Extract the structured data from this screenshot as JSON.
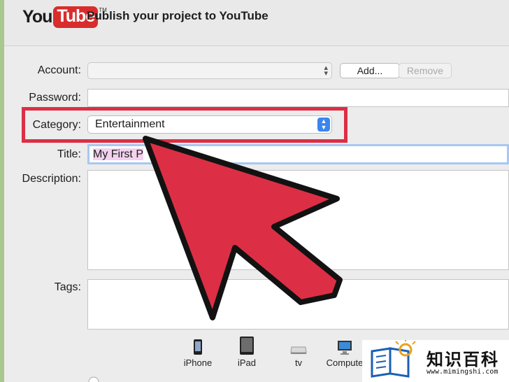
{
  "header": {
    "logo_you": "You",
    "logo_tube": "Tube",
    "logo_tm": "TM",
    "title": "Publish your project to YouTube"
  },
  "form": {
    "account_label": "Account:",
    "account_value": "",
    "add_button": "Add...",
    "remove_button": "Remove",
    "password_label": "Password:",
    "category_label": "Category:",
    "category_value": "Entertainment",
    "title_label": "Title:",
    "title_value": "My First P",
    "description_label": "Description:",
    "tags_label": "Tags:"
  },
  "devices": [
    {
      "label": "iPhone",
      "icon": "iphone-icon"
    },
    {
      "label": "iPad",
      "icon": "ipad-icon"
    },
    {
      "label": "tv",
      "icon": "apple-tv-icon"
    },
    {
      "label": "Compute",
      "icon": "computer-icon"
    }
  ],
  "watermark": {
    "text": "知识百科",
    "url": "www.mimingshi.com"
  },
  "colors": {
    "highlight": "#dc2f45",
    "arrow": "#dc2f45",
    "background": "#a8c88e",
    "category_stepper": "#3a86f0"
  }
}
